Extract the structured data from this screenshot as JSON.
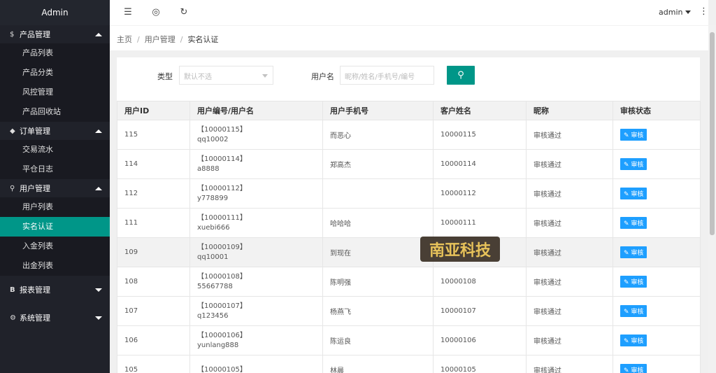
{
  "sidebar": {
    "brand": "Admin",
    "groups": [
      {
        "label": "产品管理",
        "icon": "$",
        "items": [
          "产品列表",
          "产品分类",
          "风控管理",
          "产品回收站"
        ]
      },
      {
        "label": "订单管理",
        "icon": "◆",
        "items": [
          "交易流水",
          "平仓日志"
        ]
      },
      {
        "label": "用户管理",
        "icon": "⚲",
        "items": [
          "用户列表",
          "实名认证",
          "入金列表",
          "出金列表"
        ]
      },
      {
        "label": "报表管理",
        "icon": "B"
      },
      {
        "label": "系统管理",
        "icon": "⚙"
      }
    ]
  },
  "header": {
    "user": "admin",
    "menu_icon": "☰",
    "globe_icon": "◎",
    "refresh_icon": "↻",
    "more_icon": "⋮"
  },
  "breadcrumb": {
    "home": "主页",
    "parent": "用户管理",
    "current": "实名认证"
  },
  "search": {
    "type_label": "类型",
    "type_placeholder": "默认不选",
    "user_label": "用户名",
    "user_placeholder": "昵称/姓名/手机号/编号",
    "search_icon": "🔍"
  },
  "table": {
    "headers": [
      "用户ID",
      "用户编号/用户名",
      "用户手机号",
      "客户姓名",
      "昵称",
      "审核状态"
    ],
    "rows": [
      {
        "id": "115",
        "code": "【10000115】",
        "username": "qq10002",
        "phone": "而恶心",
        "name": "10000115",
        "nick": "审核通过",
        "action": "✎ 审核"
      },
      {
        "id": "114",
        "code": "【10000114】",
        "username": "a8888",
        "phone": "郑高杰",
        "name": "10000114",
        "nick": "审核通过",
        "action": "✎ 审核"
      },
      {
        "id": "112",
        "code": "【10000112】",
        "username": "y778899",
        "phone": "",
        "name": "10000112",
        "nick": "审核通过",
        "action": "✎ 审核"
      },
      {
        "id": "111",
        "code": "【10000111】",
        "username": "xuebi666",
        "phone": "哈哈哈",
        "name": "10000111",
        "nick": "审核通过",
        "action": "✎ 审核"
      },
      {
        "id": "109",
        "code": "【10000109】",
        "username": "qq10001",
        "phone": "到现在",
        "name": "10000109",
        "nick": "审核通过",
        "action": "✎ 审核"
      },
      {
        "id": "108",
        "code": "【10000108】",
        "username": "55667788",
        "phone": "陈明强",
        "name": "10000108",
        "nick": "审核通过",
        "action": "✎ 审核"
      },
      {
        "id": "107",
        "code": "【10000107】",
        "username": "q123456",
        "phone": "杨燕飞",
        "name": "10000107",
        "nick": "审核通过",
        "action": "✎ 审核"
      },
      {
        "id": "106",
        "code": "【10000106】",
        "username": "yunlang888",
        "phone": "陈运良",
        "name": "10000106",
        "nick": "审核通过",
        "action": "✎ 审核"
      },
      {
        "id": "105",
        "code": "【10000105】",
        "username": "",
        "phone": "林晨",
        "name": "10000105",
        "nick": "审核通过",
        "action": "✎ 审核"
      }
    ]
  },
  "watermark": {
    "text": "南亚科技"
  },
  "colors": {
    "sidebar": "#20222a",
    "active": "#009688",
    "button": "#1e9fff"
  }
}
